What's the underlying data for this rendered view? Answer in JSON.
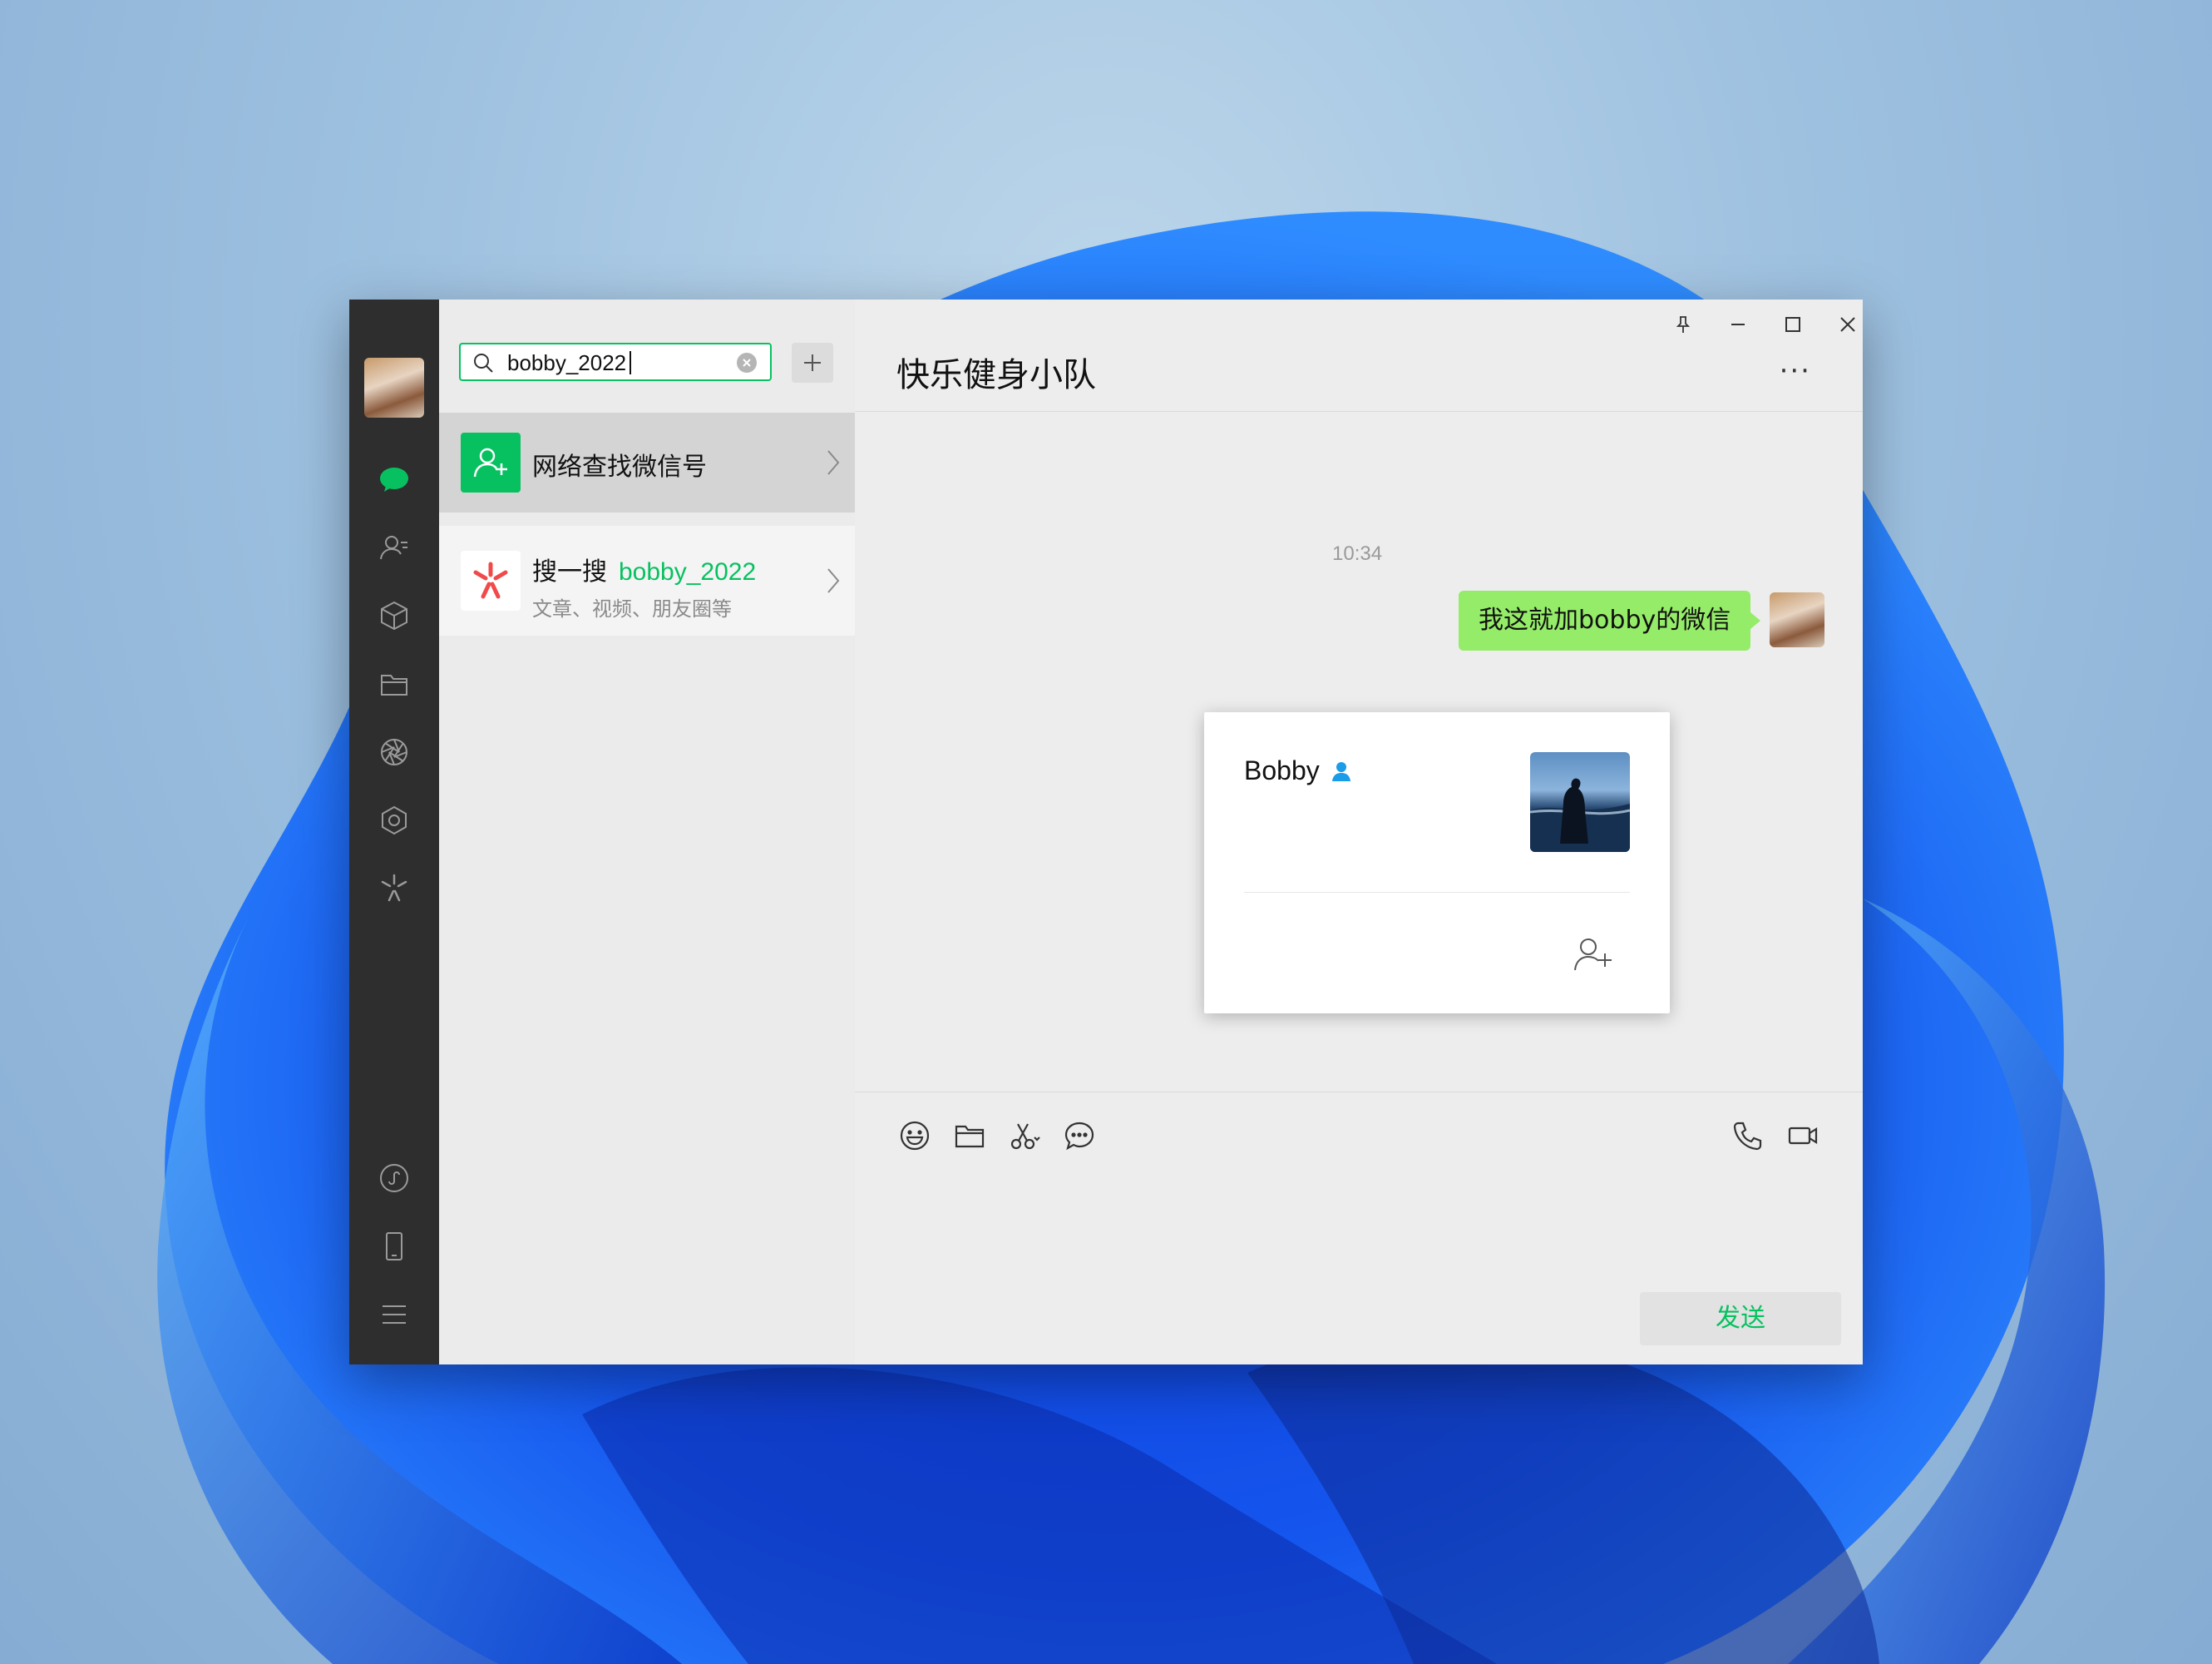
{
  "search": {
    "value": "bobby_2022"
  },
  "results": {
    "network": {
      "label": "网络查找微信号"
    },
    "sousou": {
      "prefix": "搜一搜",
      "keyword": "bobby_2022",
      "subtitle": "文章、视频、朋友圈等"
    }
  },
  "chat": {
    "title": "快乐健身小队",
    "more": "···",
    "timestamp": "10:34",
    "messages": [
      {
        "text": "我这就加bobby的微信",
        "from": "me"
      }
    ],
    "send_label": "发送"
  },
  "profile_card": {
    "name": "Bobby"
  },
  "nav": {
    "items": [
      "chat-icon",
      "contacts-icon",
      "favorites-icon",
      "files-icon",
      "moments-icon",
      "channels-icon",
      "sousou-icon",
      "mini-programs-icon",
      "phone-icon",
      "menu-icon"
    ]
  },
  "colors": {
    "accent": "#07c160",
    "bubble_me": "#95ec69",
    "nav_bg": "#2e2e2e"
  }
}
